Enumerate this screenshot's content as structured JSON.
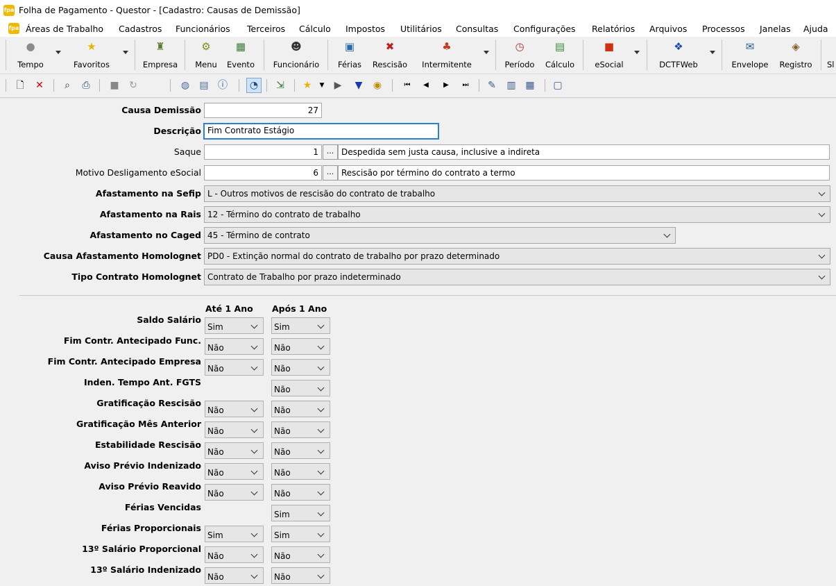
{
  "window": {
    "title": "Folha de Pagamento - Questor - [Cadastro: Causas de Demissão]",
    "app_icon": "fpa"
  },
  "menu": [
    "Áreas de Trabalho",
    "Cadastros",
    "Funcionários",
    "Terceiros",
    "Cálculo",
    "Impostos",
    "Utilitários",
    "Consultas",
    "Configurações",
    "Relatórios",
    "Arquivos",
    "Processos",
    "Janelas",
    "Ajuda"
  ],
  "toolbar": {
    "buttons": [
      {
        "label": "Tempo",
        "icon": "status-light-icon"
      },
      {
        "label": "Favoritos",
        "icon": "star-icon"
      },
      {
        "label": "Empresa",
        "icon": "company-icon"
      },
      {
        "label": "Menu",
        "icon": "menu-icon"
      },
      {
        "label": "Evento",
        "icon": "event-icon"
      },
      {
        "label": "Funcionário",
        "icon": "employee-icon"
      },
      {
        "label": "Férias",
        "icon": "vacation-icon"
      },
      {
        "label": "Rescisão",
        "icon": "termination-icon"
      },
      {
        "label": "Intermitente",
        "icon": "intermittent-icon"
      },
      {
        "label": "Período",
        "icon": "period-icon"
      },
      {
        "label": "Cálculo",
        "icon": "calculation-icon"
      },
      {
        "label": "eSocial",
        "icon": "esocial-icon"
      },
      {
        "label": "DCTFWeb",
        "icon": "dctfweb-icon"
      },
      {
        "label": "Envelope",
        "icon": "envelope-icon"
      },
      {
        "label": "Registro",
        "icon": "register-icon"
      },
      {
        "label": "Sl",
        "icon": "more-icon"
      }
    ]
  },
  "form": {
    "causa_demissao": {
      "label": "Causa Demissão",
      "value": "27"
    },
    "descricao": {
      "label": "Descrição",
      "value": "Fim Contrato Estágio"
    },
    "saque": {
      "label": "Saque",
      "code": "1",
      "text": "Despedida sem justa causa, inclusive a indireta"
    },
    "motivo": {
      "label": "Motivo Desligamento eSocial",
      "code": "6",
      "text": "Rescisão por término do contrato a termo"
    },
    "sefip": {
      "label": "Afastamento na Sefip",
      "value": "L - Outros motivos de rescisão do contrato de trabalho"
    },
    "rais": {
      "label": "Afastamento na Rais",
      "value": "12 - Término do contrato de trabalho"
    },
    "caged": {
      "label": "Afastamento no Caged",
      "value": "45 - Término de contrato"
    },
    "homolognet_causa": {
      "label": "Causa Afastamento Homolognet",
      "value": "PD0 - Extinção normal do contrato de trabalho por prazo determinado"
    },
    "homolognet_tipo": {
      "label": "Tipo Contrato Homolognet",
      "value": "Contrato de Trabalho por prazo indeterminado"
    }
  },
  "grid": {
    "col1": "Até 1 Ano",
    "col2": "Após 1 Ano",
    "rows": [
      {
        "label": "Saldo Salário",
        "a": "Sim",
        "b": "Sim"
      },
      {
        "label": "Fim Contr. Antecipado Func.",
        "a": "Não",
        "b": "Não"
      },
      {
        "label": "Fim Contr. Antecipado Empresa",
        "a": "Não",
        "b": "Não"
      },
      {
        "label": "Inden. Tempo Ant. FGTS",
        "a": "",
        "b": "Não"
      },
      {
        "label": "Gratificação Rescisão",
        "a": "Não",
        "b": "Não"
      },
      {
        "label": "Gratificação Mês Anterior",
        "a": "Não",
        "b": "Não"
      },
      {
        "label": "Estabilidade Rescisão",
        "a": "Não",
        "b": "Não"
      },
      {
        "label": "Aviso Prévio Indenizado",
        "a": "Não",
        "b": "Não"
      },
      {
        "label": "Aviso Prévio Reavido",
        "a": "Não",
        "b": "Não"
      },
      {
        "label": "Férias Vencidas",
        "a": "",
        "b": "Sim"
      },
      {
        "label": "Férias Proporcionais",
        "a": "Sim",
        "b": "Sim"
      },
      {
        "label": "13º Salário Proporcional",
        "a": "Não",
        "b": "Não"
      },
      {
        "label": "13º Salário Indenizado",
        "a": "Não",
        "b": "Não"
      }
    ]
  }
}
